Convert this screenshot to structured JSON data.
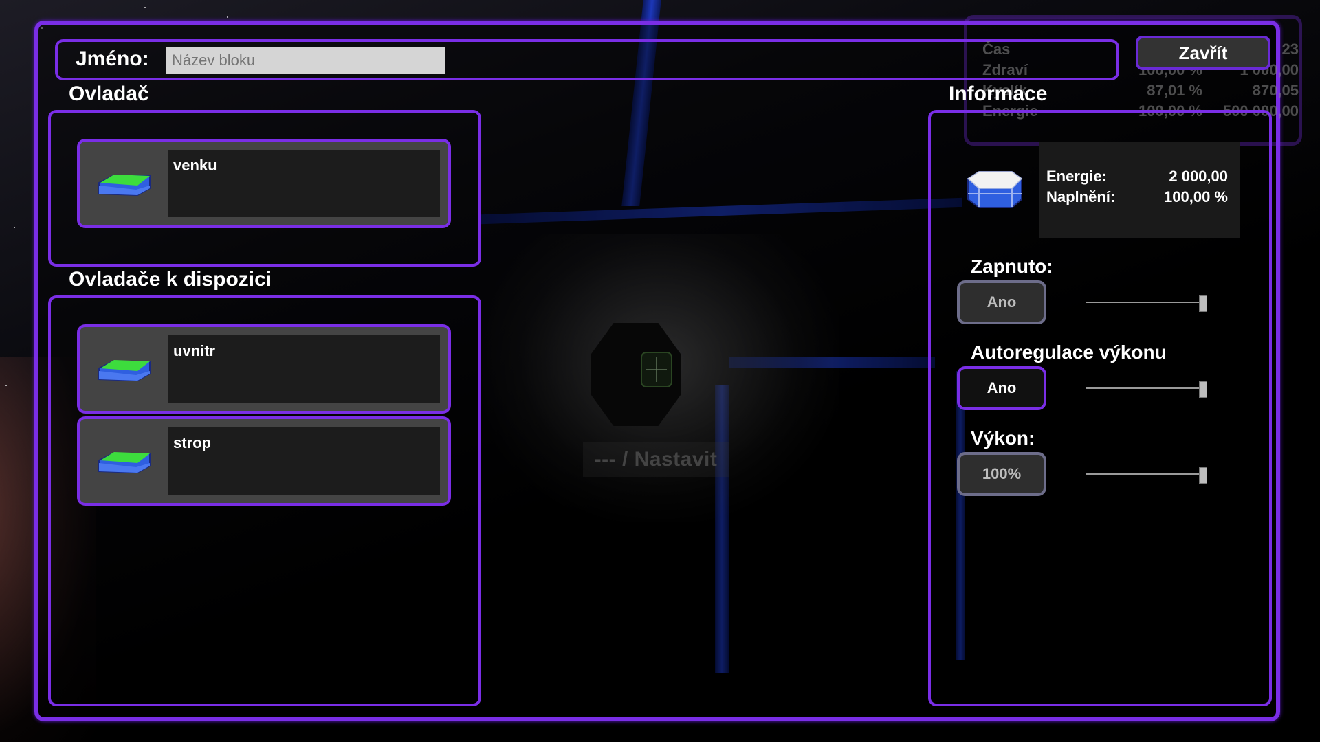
{
  "name_field": {
    "label": "Jméno:",
    "placeholder": "Název bloku",
    "value": ""
  },
  "close_label": "Zavřít",
  "hud": {
    "rows": [
      {
        "label": "Čas",
        "percent": "",
        "value": "23"
      },
      {
        "label": "Zdraví",
        "percent": "100,00 %",
        "value": "1 000,00"
      },
      {
        "label": "Kyslík",
        "percent": "87,01 %",
        "value": "870,05"
      },
      {
        "label": "Energie",
        "percent": "100,00 %",
        "value": "500 000,00"
      }
    ]
  },
  "controller": {
    "title": "Ovladač",
    "items": [
      {
        "label": "venku",
        "icon": "controller-block-icon"
      }
    ]
  },
  "available": {
    "title": "Ovladače k dispozici",
    "items": [
      {
        "label": "uvnitr",
        "icon": "controller-block-icon"
      },
      {
        "label": "strop",
        "icon": "controller-block-icon"
      }
    ]
  },
  "crosshair_hint": "--- / Nastavit",
  "info": {
    "title": "Informace",
    "icon": "battery-block-icon",
    "energy_label": "Energie:",
    "energy_value": "2 000,00",
    "fill_label": "Naplnění:",
    "fill_value": "100,00 %"
  },
  "controls": {
    "power": {
      "label": "Zapnuto:",
      "value": "Ano",
      "slider_level": 1.0
    },
    "auto": {
      "label": "Autoregulace výkonu",
      "value": "Ano",
      "slider_level": 1.0
    },
    "output": {
      "label": "Výkon:",
      "value": "100%",
      "slider_level": 1.0
    }
  },
  "colors": {
    "accent": "#7a2ee6",
    "block_top": "#3ddc3d",
    "block_side": "#2f5fe0"
  }
}
